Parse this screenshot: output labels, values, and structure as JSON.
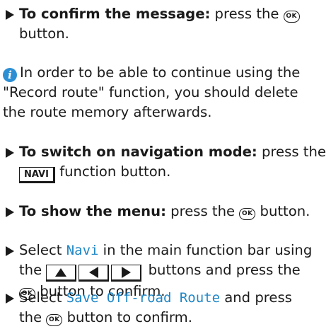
{
  "steps": [
    {
      "bold": "To confirm the message:",
      "before": " press the ",
      "after": "button."
    },
    {
      "bold": "To switch on navigation mode:",
      "before": " press the",
      "key": "NAVI",
      "after": "function button."
    },
    {
      "bold": "To show the menu:",
      "before": " press the ",
      "after": " button."
    },
    {
      "before": "Select ",
      "display": "Navi",
      "middle": " in the main function bar using",
      "pre_arrows": "the ",
      "post_arrows": " buttons and press the",
      "after": " button to confirm."
    },
    {
      "before": "Select ",
      "display": "Save Off-road Route",
      "middle": " and press",
      "pre_ok": "the ",
      "after": " button to confirm."
    }
  ],
  "note": {
    "icon": "info-icon",
    "line1": "In order to be able to continue using the",
    "line2": "\"Record route\" function, you should delete",
    "line3": "the route memory afterwards."
  },
  "ok_label": "OK",
  "colors": {
    "display_text": "#1f86c6",
    "info_icon": "#2c8fd4",
    "text": "#1a1a1a"
  }
}
